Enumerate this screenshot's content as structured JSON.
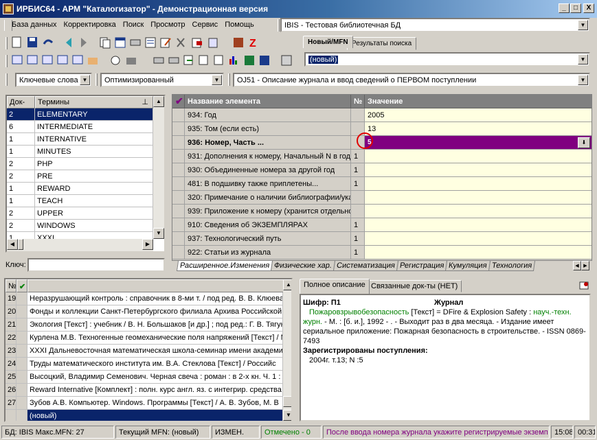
{
  "window": {
    "title": "ИРБИС64 - АРМ \"Каталогизатор\" - Демонстрационная версия",
    "min": "_",
    "max": "□",
    "close": "X"
  },
  "menu": [
    "База данных",
    "Корректировка",
    "Поиск",
    "Просмотр",
    "Сервис",
    "Помощь"
  ],
  "db_select": "IBIS - Тестовая библиотечная БД",
  "tabs_top": [
    "Новый/MFN",
    "Результаты поиска"
  ],
  "mfn_value": "(новый)",
  "search_mode": "Ключевые слова",
  "search_option": "Оптимизированный",
  "worksheet": "OJ51 - Описание журнала и ввод сведений о ПЕРВОМ поступлении",
  "terms": {
    "headers": [
      "Док-ов",
      "Термины"
    ],
    "pin": "⊥",
    "rows": [
      [
        "2",
        "ELEMENTARY"
      ],
      [
        "6",
        "INTERMEDIATE"
      ],
      [
        "1",
        "INTERNATIVE"
      ],
      [
        "1",
        "MINUTES"
      ],
      [
        "2",
        "PHP"
      ],
      [
        "2",
        "PRE"
      ],
      [
        "1",
        "REWARD"
      ],
      [
        "1",
        "TEACH"
      ],
      [
        "2",
        "UPPER"
      ],
      [
        "2",
        "WINDOWS"
      ],
      [
        "1",
        "XXXI"
      ]
    ]
  },
  "key_label": "Ключ:",
  "fields": {
    "headers": [
      "Название элемента",
      "№",
      "Значение"
    ],
    "rows": [
      {
        "name": "934: Год",
        "num": "",
        "val": "2005"
      },
      {
        "name": "935: Том (если есть)",
        "num": "",
        "val": "13"
      },
      {
        "name": "936: Номер, Часть ...",
        "num": "",
        "val": "5"
      },
      {
        "name": "931: Дополнения к номеру, Начальный N в году",
        "num": "1",
        "val": ""
      },
      {
        "name": "930: Объединенные номера за другой год",
        "num": "1",
        "val": ""
      },
      {
        "name": "481: В подшивку также приплетены...",
        "num": "1",
        "val": ""
      },
      {
        "name": "320: Примечание о наличии библиографии/указ",
        "num": "",
        "val": ""
      },
      {
        "name": "939: Приложение к номеру (хранится отдельно)",
        "num": "",
        "val": ""
      },
      {
        "name": "910: Сведения об ЭКЗЕМПЛЯРАХ",
        "num": "1",
        "val": ""
      },
      {
        "name": "937: Технологический путь",
        "num": "1",
        "val": ""
      },
      {
        "name": "922: Статьи из журнала",
        "num": "1",
        "val": ""
      }
    ]
  },
  "field_tabs": [
    "Расширенное.Изменения",
    "Физические хар.",
    "Систематизация",
    "Регистрация",
    "Кумуляция",
    "Технология"
  ],
  "records": {
    "header_no": "№",
    "rows": [
      {
        "n": "19",
        "t": "Неразрушающий контроль : справочник в 8-ми т. / под ред. В. В. Клюева"
      },
      {
        "n": "20",
        "t": "Фонды и коллекции Санкт-Петербургского филиала Архива Российской"
      },
      {
        "n": "21",
        "t": "Экология [Текст] : учебник / В. Н. Большаков [и др.] ; под ред.: Г. В. Тягун"
      },
      {
        "n": "22",
        "t": "Курлена М.В. Техногенные геомеханические поля напряжений [Текст] / М"
      },
      {
        "n": "23",
        "t": "XXXI Дальневосточная математическая школа-семинар имени академи"
      },
      {
        "n": "24",
        "t": "Труды математического института им. В.А. Стеклова [Текст] / Российс"
      },
      {
        "n": "25",
        "t": "Высоцкий, Владимир Семенович. Черная свеча : роман : в 2-х кн. Ч. 1 : П"
      },
      {
        "n": "26",
        "t": "Reward Internative [Комплект] : полн. курс англ. яз. с интегрир. средства"
      },
      {
        "n": "27",
        "t": "Зубов А.В. Компьютер. Windows. Программы [Текст] / А. В. Зубов, М. В"
      },
      {
        "n": "",
        "t": "(новый)"
      }
    ]
  },
  "desc_tabs": [
    "Полное описание",
    "Связанные док-ты (НЕТ)"
  ],
  "desc": {
    "shifr": "Шифр: П1",
    "type": "Журнал",
    "title_link": "Пожаровзрывобезопасность",
    "title_rest": " [Текст] = DFire & Explosion Safety : ",
    "link2": "науч.-техн. журн.",
    "body": " - М. : [б. и.], 1992 -    . - Выходит раз в два месяца. - Издание имеет сериальное приложение: Пожарная безопасность в строительстве. - ISSN 0869-7493",
    "reg_title": "Зарегистрированы поступления:",
    "reg": "2004г. т.13; N :5"
  },
  "status": {
    "db": "БД: IBIS Макс.MFN: 27",
    "cur": "Текущий MFN: (новый)",
    "chg": "ИЗМЕН.",
    "marked": "Отмечено - 0",
    "hint": "После ввода номера журнала укажите регистрируемые экземп",
    "time": "15:08",
    "sec": "00:31"
  },
  "colors": {
    "title_start": "#0a246a",
    "selection": "#0a246a",
    "field_edit": "#800080",
    "value_bg": "#ffffe1",
    "marked": "#008000",
    "hint": "#800080"
  }
}
